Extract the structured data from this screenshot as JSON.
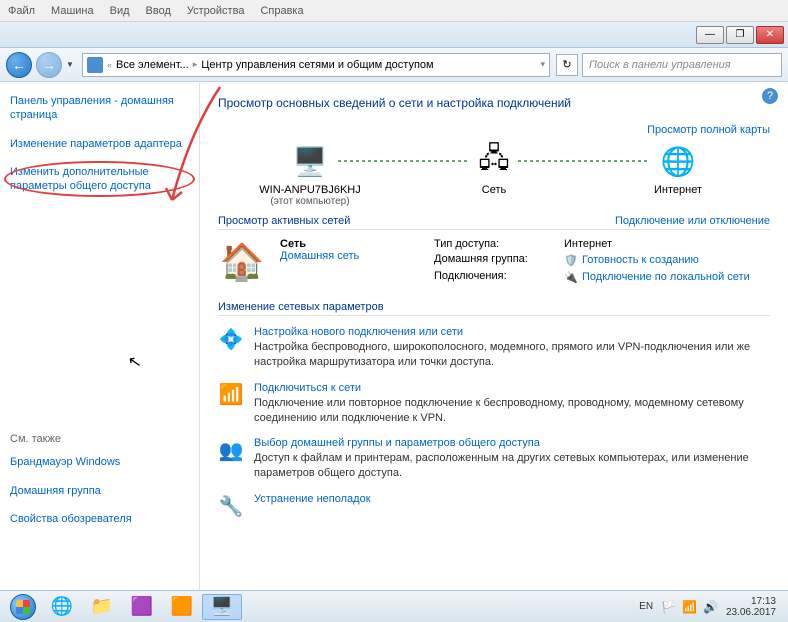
{
  "vm_menu": [
    "Файл",
    "Машина",
    "Вид",
    "Ввод",
    "Устройства",
    "Справка"
  ],
  "window_controls": {
    "min": "—",
    "max": "❐",
    "close": "✕"
  },
  "nav": {
    "crumb1": "Все элемент...",
    "crumb2": "Центр управления сетями и общим доступом",
    "search_placeholder": "Поиск в панели управления"
  },
  "sidebar": {
    "home": "Панель управления - домашняя страница",
    "adapter": "Изменение параметров адаптера",
    "advanced": "Изменить дополнительные параметры общего доступа",
    "see_also": "См. также",
    "firewall": "Брандмауэр Windows",
    "homegroup": "Домашняя группа",
    "browser": "Свойства обозревателя"
  },
  "main": {
    "heading": "Просмотр основных сведений о сети и настройка подключений",
    "full_map": "Просмотр полной карты",
    "nodes": {
      "pc_name": "WIN-ANPU7BJ6KHJ",
      "pc_sub": "(этот компьютер)",
      "net": "Сеть",
      "internet": "Интернет"
    },
    "active_header": "Просмотр активных сетей",
    "connect_link": "Подключение или отключение",
    "network": {
      "name": "Сеть",
      "type": "Домашняя сеть",
      "access_k": "Тип доступа:",
      "access_v": "Интернет",
      "group_k": "Домашняя группа:",
      "group_v": "Готовность к созданию",
      "conn_k": "Подключения:",
      "conn_v": "Подключение по локальной сети"
    },
    "change_heading": "Изменение сетевых параметров",
    "tasks": [
      {
        "title": "Настройка нового подключения или сети",
        "desc": "Настройка беспроводного, широкополосного, модемного, прямого или VPN-подключения или же настройка маршрутизатора или точки доступа."
      },
      {
        "title": "Подключиться к сети",
        "desc": "Подключение или повторное подключение к беспроводному, проводному, модемному сетевому соединению или подключение к VPN."
      },
      {
        "title": "Выбор домашней группы и параметров общего доступа",
        "desc": "Доступ к файлам и принтерам, расположенным на других сетевых компьютерах, или изменение параметров общего доступа."
      },
      {
        "title": "Устранение неполадок",
        "desc": ""
      }
    ]
  },
  "taskbar": {
    "lang": "EN",
    "time": "17:13",
    "date": "23.06.2017"
  }
}
